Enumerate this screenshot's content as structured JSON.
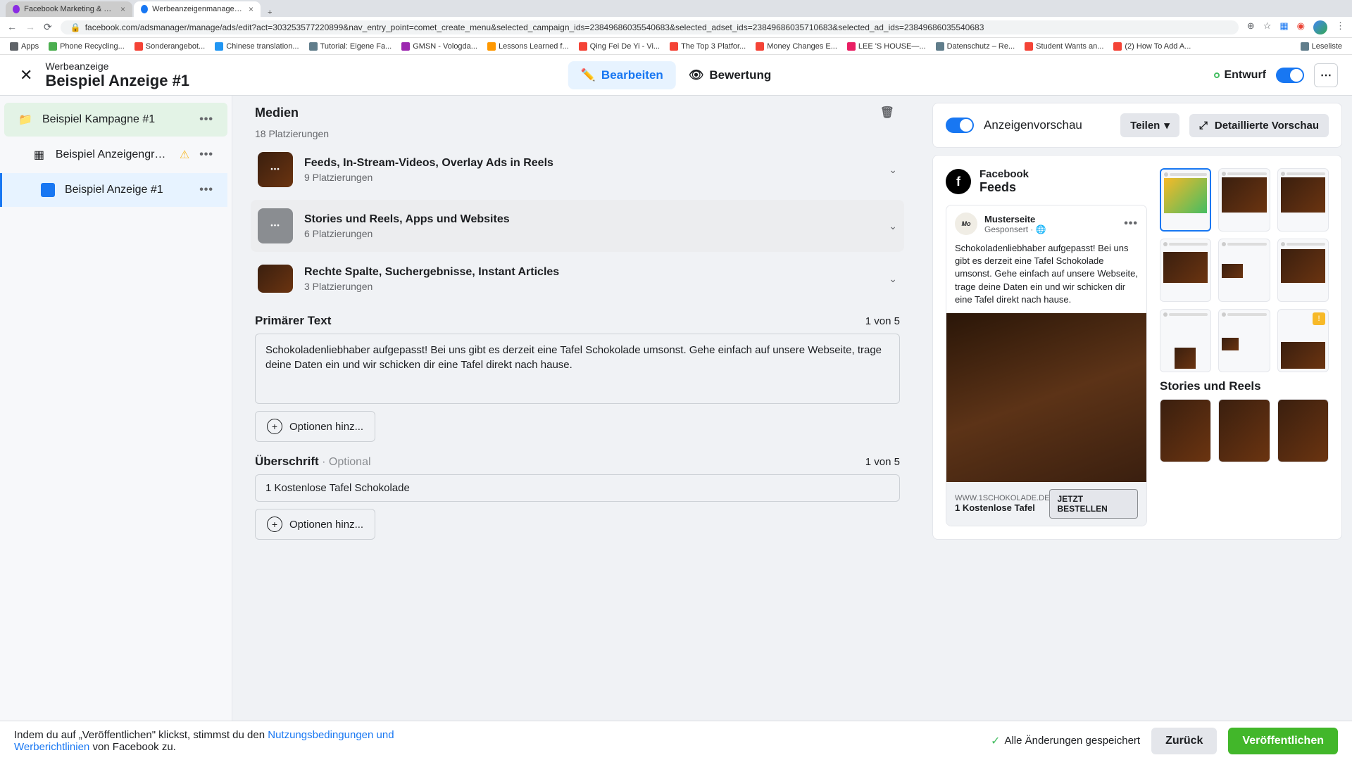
{
  "browser": {
    "tabs": [
      {
        "title": "Facebook Marketing & Werbe...",
        "active": false
      },
      {
        "title": "Werbeanzeigenmanager - We...",
        "active": true
      }
    ],
    "url": "facebook.com/adsmanager/manage/ads/edit?act=303253577220899&nav_entry_point=comet_create_menu&selected_campaign_ids=23849686035540683&selected_adset_ids=23849686035710683&selected_ad_ids=23849686035540683",
    "bookmarks": [
      "Apps",
      "Phone Recycling...",
      "Sonderangebot...",
      "Chinese translation...",
      "Tutorial: Eigene Fa...",
      "GMSN - Vologda...",
      "Lessons Learned f...",
      "Qing Fei De Yi - Vi...",
      "The Top 3 Platfor...",
      "Money Changes E...",
      "LEE 'S HOUSE—...",
      "Datenschutz – Re...",
      "Student Wants an...",
      "(2) How To Add A..."
    ],
    "reading_list": "Leseliste"
  },
  "header": {
    "subtitle": "Werbeanzeige",
    "title": "Beispiel Anzeige #1",
    "edit": "Bearbeiten",
    "review": "Bewertung",
    "status": "Entwurf"
  },
  "sidebar": {
    "campaign": "Beispiel Kampagne #1",
    "adset": "Beispiel Anzeigengrup...",
    "ad": "Beispiel Anzeige #1"
  },
  "media": {
    "title": "Medien",
    "sub": "18 Platzierungen",
    "rows": [
      {
        "title": "Feeds, In-Stream-Videos, Overlay Ads in Reels",
        "sub": "9 Platzierungen"
      },
      {
        "title": "Stories und Reels, Apps und Websites",
        "sub": "6 Platzierungen"
      },
      {
        "title": "Rechte Spalte, Suchergebnisse, Instant Articles",
        "sub": "3 Platzierungen"
      }
    ]
  },
  "primary_text": {
    "label": "Primärer Text",
    "count": "1 von 5",
    "value": "Schokoladenliebhaber aufgepasst! Bei uns gibt es derzeit eine Tafel Schokolade umsonst. Gehe einfach auf unsere Webseite, trage deine Daten ein und wir schicken dir eine Tafel direkt nach hause.",
    "add": "Optionen hinz..."
  },
  "headline": {
    "label": "Überschrift",
    "optional": "Optional",
    "count": "1 von 5",
    "value": "1 Kostenlose Tafel Schokolade",
    "add": "Optionen hinz..."
  },
  "preview": {
    "title": "Anzeigenvorschau",
    "share": "Teilen",
    "expand": "Detaillierte Vorschau",
    "platform": "Facebook",
    "section": "Feeds",
    "page_name": "Musterseite",
    "sponsored": "Gesponsert",
    "body": "Schokoladenliebhaber aufgepasst! Bei uns gibt es derzeit eine Tafel Schokolade umsonst. Gehe einfach auf unsere Webseite, trage deine Daten ein und wir schicken dir eine Tafel direkt nach hause.",
    "domain": "WWW.1SCHOKOLADE.DE",
    "headline": "1 Kostenlose Tafel",
    "cta": "JETZT BESTELLEN",
    "grid_sections": {
      "stories": "Stories und Reels"
    }
  },
  "footer": {
    "terms_prefix": "Indem du auf „Veröffentlichen\" klickst, stimmst du den ",
    "terms_link": "Nutzungsbedingungen und Werberichtlinien",
    "terms_suffix": " von Facebook zu.",
    "saved": "Alle Änderungen gespeichert",
    "back": "Zurück",
    "publish": "Veröffentlichen"
  }
}
